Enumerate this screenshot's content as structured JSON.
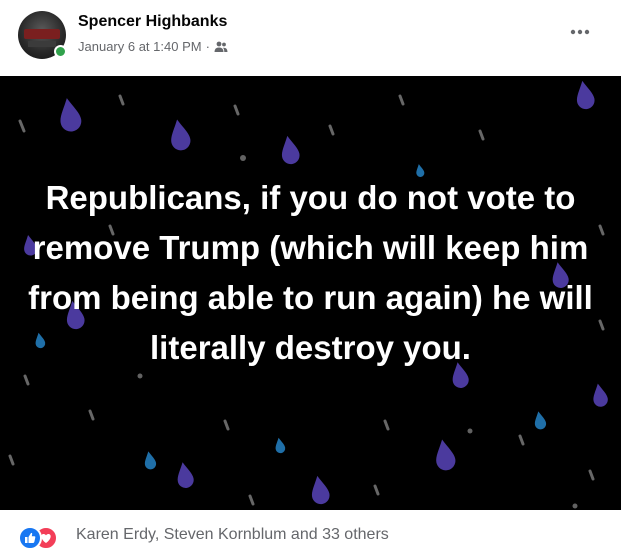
{
  "post": {
    "author": "Spencer Highbanks",
    "timestamp": "January 6 at 1:40 PM",
    "separator": "·",
    "audience_icon": "friends-icon",
    "online_status_color": "#31a24c"
  },
  "image_text": {
    "quote": "Republicans, if you do not vote to remove Trump (which will keep him from being able to run again) he will literally destroy you."
  },
  "reactions": {
    "types": [
      "like-icon",
      "love-icon"
    ],
    "summary": "Karen Erdy, Steven Kornblum and 33 others"
  },
  "colors": {
    "image_background": "#000000",
    "drop_purple": "#4b3a9e",
    "drop_blue": "#1f6fa8",
    "drop_gray": "#8a8a8a",
    "like": "#1877f2",
    "love": "#f33e58"
  }
}
